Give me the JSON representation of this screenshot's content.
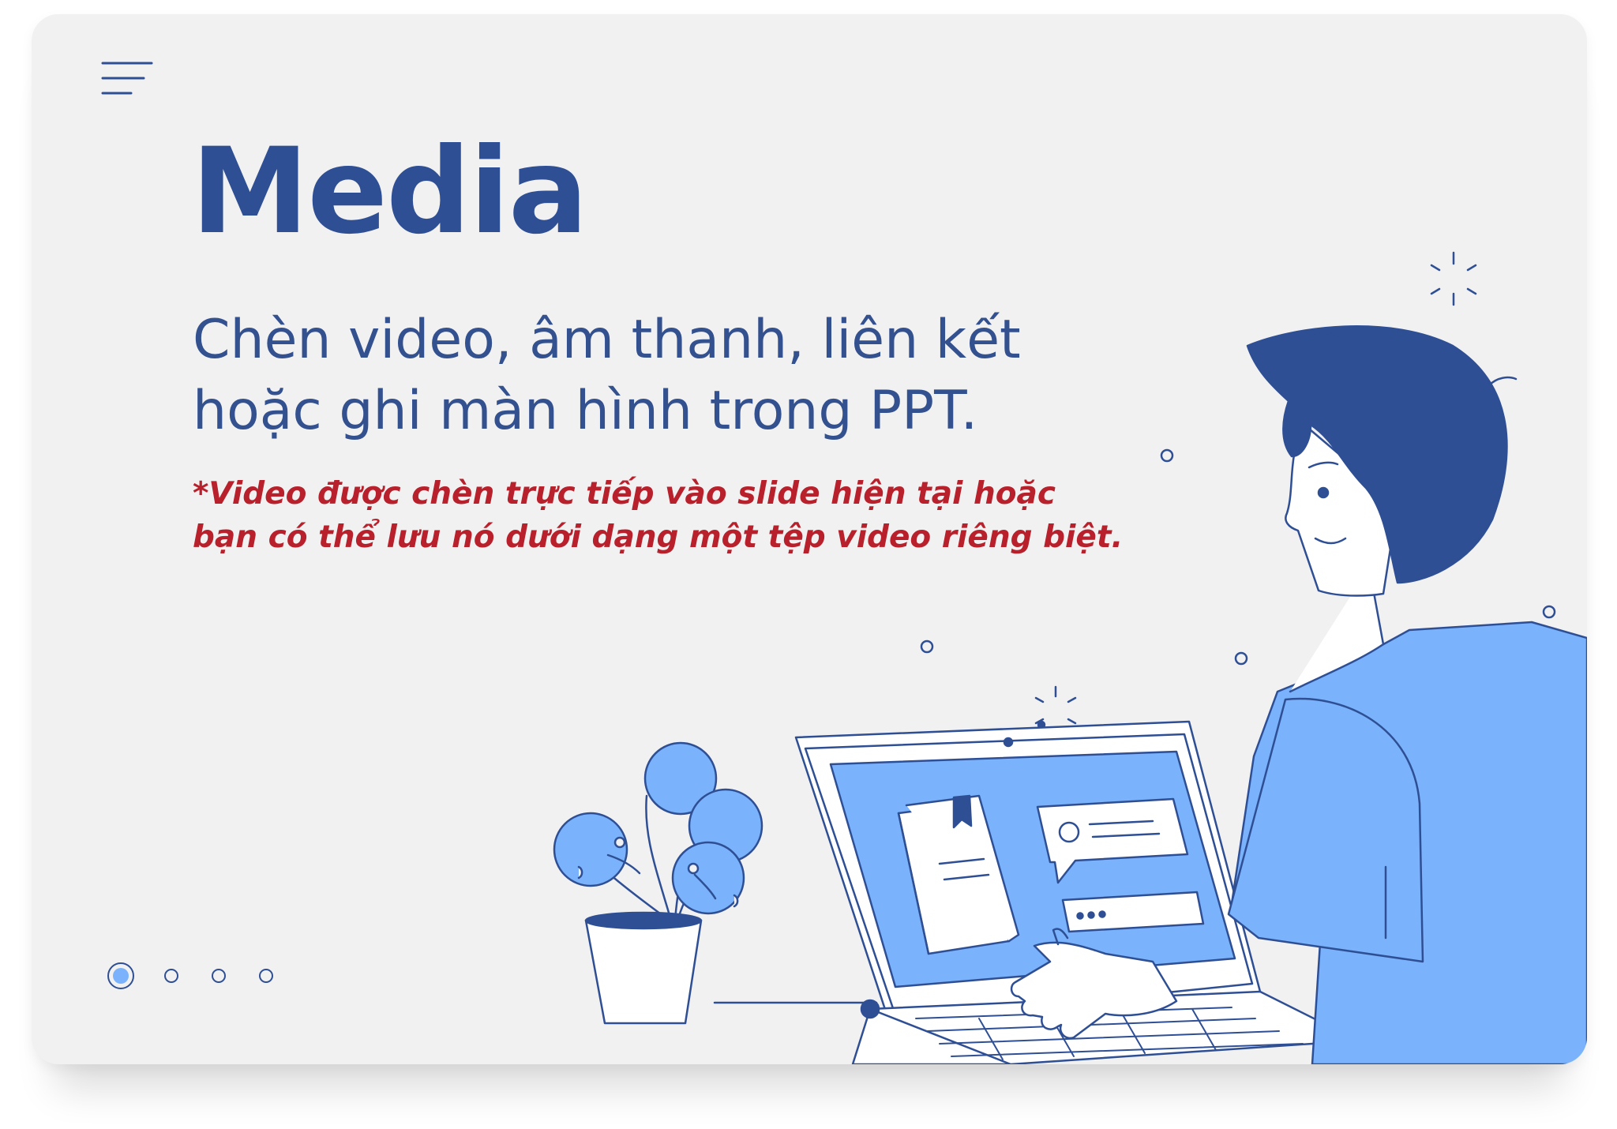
{
  "slide": {
    "title": "Media",
    "subtitle_lines": [
      "Chèn video, âm thanh, liên kết",
      "hoặc ghi màn hình trong PPT."
    ],
    "note_lines": [
      "*Video được chèn trực tiếp vào slide hiện tại hoặc",
      "bạn có thể lưu nó dưới dạng một tệp video riêng biệt."
    ]
  },
  "navigation": {
    "menu_icon": "hamburger-menu-icon",
    "pages": [
      {
        "active": true
      },
      {
        "active": false
      },
      {
        "active": false
      },
      {
        "active": false
      }
    ]
  },
  "colors": {
    "background": "#f1f1f2",
    "primary_navy": "#2f4f94",
    "accent_blue": "#7ab3fb",
    "note_red": "#b8202b"
  },
  "illustration": {
    "icons": [
      "person-icon",
      "laptop-icon",
      "plant-icon",
      "book-icon",
      "chat-bubble-icon",
      "password-field-icon"
    ]
  }
}
